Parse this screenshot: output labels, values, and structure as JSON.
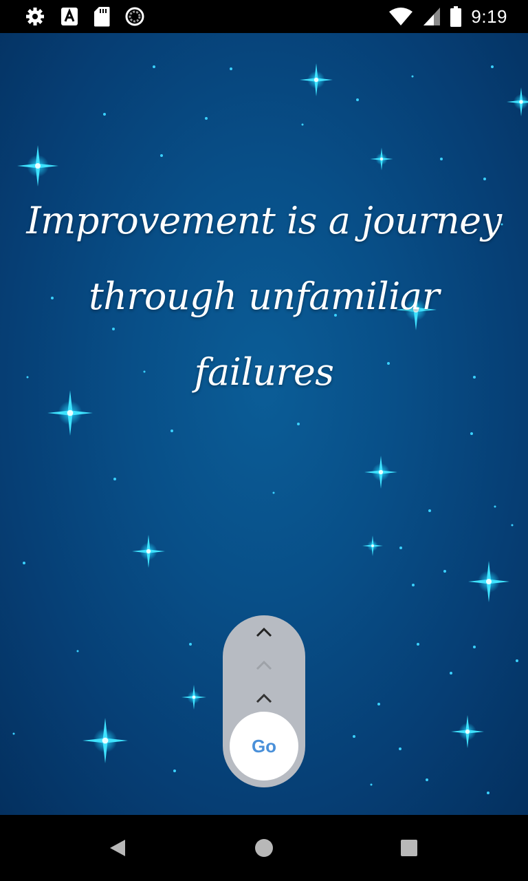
{
  "status_bar": {
    "time": "9:19",
    "icons_left": [
      "settings-gear-icon",
      "text-a-notification-icon",
      "sd-card-icon",
      "sync-circle-icon"
    ],
    "icons_right": [
      "wifi-icon",
      "cellular-signal-icon",
      "battery-icon"
    ]
  },
  "quote": {
    "text": "Improvement is a journey through unfamiliar failures"
  },
  "swipe_control": {
    "go_label": "Go",
    "chevrons": [
      "chevron-up-icon",
      "chevron-up-icon",
      "chevron-up-icon"
    ]
  },
  "navigation_bar": {
    "buttons": [
      "back",
      "home",
      "recents"
    ]
  },
  "colors": {
    "background_top": "#0b5d97",
    "background_bottom": "#04305f",
    "star_glow": "#1fd7ff",
    "pill": "#b7bbc2",
    "go_text": "#4a90d9",
    "quote_text": "#ffffff"
  }
}
